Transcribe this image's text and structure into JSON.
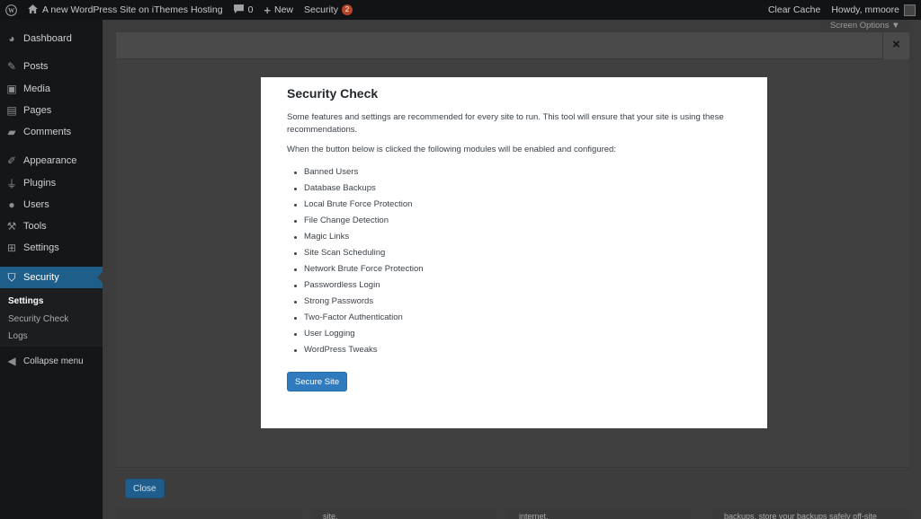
{
  "adminbar": {
    "site_name": "A new WordPress Site on iThemes Hosting",
    "comments_count": "0",
    "new_label": "New",
    "security_label": "Security",
    "security_badge": "2",
    "clear_cache": "Clear Cache",
    "howdy": "Howdy, mmoore"
  },
  "sidebar": {
    "items": [
      {
        "label": "Dashboard",
        "icon": "dashboard-icon"
      },
      {
        "label": "Posts",
        "icon": "pin-icon"
      },
      {
        "label": "Media",
        "icon": "media-icon"
      },
      {
        "label": "Pages",
        "icon": "pages-icon"
      },
      {
        "label": "Comments",
        "icon": "comment-icon"
      },
      {
        "label": "Appearance",
        "icon": "brush-icon"
      },
      {
        "label": "Plugins",
        "icon": "plug-icon"
      },
      {
        "label": "Users",
        "icon": "user-icon"
      },
      {
        "label": "Tools",
        "icon": "wrench-icon"
      },
      {
        "label": "Settings",
        "icon": "settings-icon"
      },
      {
        "label": "Security",
        "icon": "shield-icon"
      }
    ],
    "submenu": [
      "Settings",
      "Security Check",
      "Logs"
    ],
    "collapse": "Collapse menu"
  },
  "screen_options": "Screen Options ▼",
  "background": {
    "close_label": "Close",
    "close_x": "×",
    "under_texts": [
      "site.",
      "internet.",
      "backups, store your backups safely off-site"
    ]
  },
  "modal": {
    "title": "Security Check",
    "intro": "Some features and settings are recommended for every site to run. This tool will ensure that your site is using these recommendations.",
    "lead": "When the button below is clicked the following modules will be enabled and configured:",
    "modules": [
      "Banned Users",
      "Database Backups",
      "Local Brute Force Protection",
      "File Change Detection",
      "Magic Links",
      "Site Scan Scheduling",
      "Network Brute Force Protection",
      "Passwordless Login",
      "Strong Passwords",
      "Two-Factor Authentication",
      "User Logging",
      "WordPress Tweaks"
    ],
    "button": "Secure Site"
  }
}
